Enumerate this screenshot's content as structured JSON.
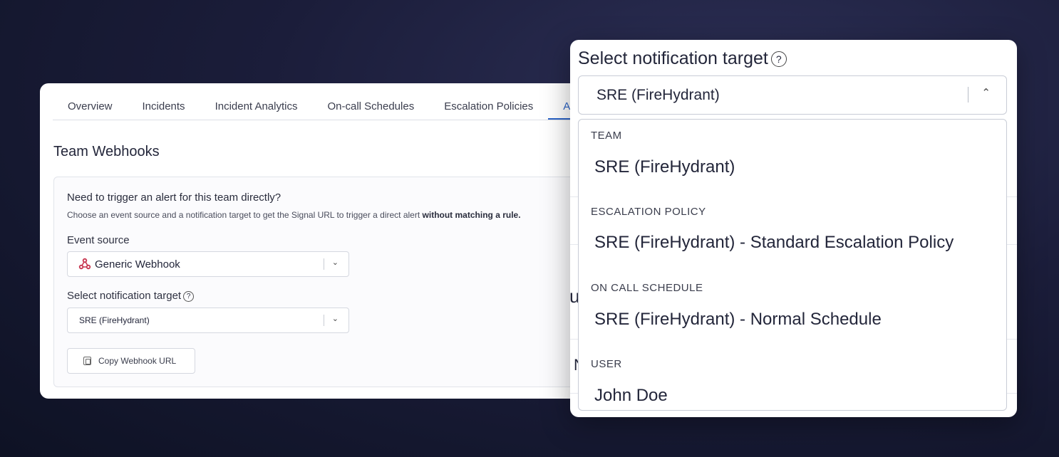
{
  "tabs": [
    "Overview",
    "Incidents",
    "Incident Analytics",
    "On-call Schedules",
    "Escalation Policies",
    "A"
  ],
  "active_tab": "A",
  "section_title": "Team Webhooks",
  "card": {
    "heading": "Need to trigger an alert for this team directly?",
    "description": "Choose an event source and a notification target to get the Signal URL to trigger a direct alert",
    "description_bold": "without matching a rule.",
    "event_source_label": "Event source",
    "event_source_value": "Generic Webhook",
    "target_label": "Select notification target",
    "target_value": "SRE (FireHydrant)",
    "copy_button": "Copy Webhook URL"
  },
  "popup": {
    "title": "Select notification target",
    "selected": "SRE (FireHydrant)",
    "groups": [
      {
        "label": "TEAM",
        "option": "SRE (FireHydrant)"
      },
      {
        "label": "ESCALATION POLICY",
        "option": "SRE (FireHydrant) - Standard Escalation Policy"
      },
      {
        "label": "ON CALL SCHEDULE",
        "option": "SRE (FireHydrant) - Normal Schedule"
      },
      {
        "label": "USER",
        "option": "John Doe"
      }
    ],
    "ghost_left_1": "u",
    "ghost_left_2": "N"
  },
  "icons": {
    "help": "help-circle-icon",
    "chevron_down": "chevron-down-icon",
    "chevron_up": "chevron-up-icon",
    "webhook": "webhook-icon",
    "copy": "copy-icon"
  },
  "colors": {
    "accent": "#2a63c8",
    "webhook": "#c7354f"
  }
}
